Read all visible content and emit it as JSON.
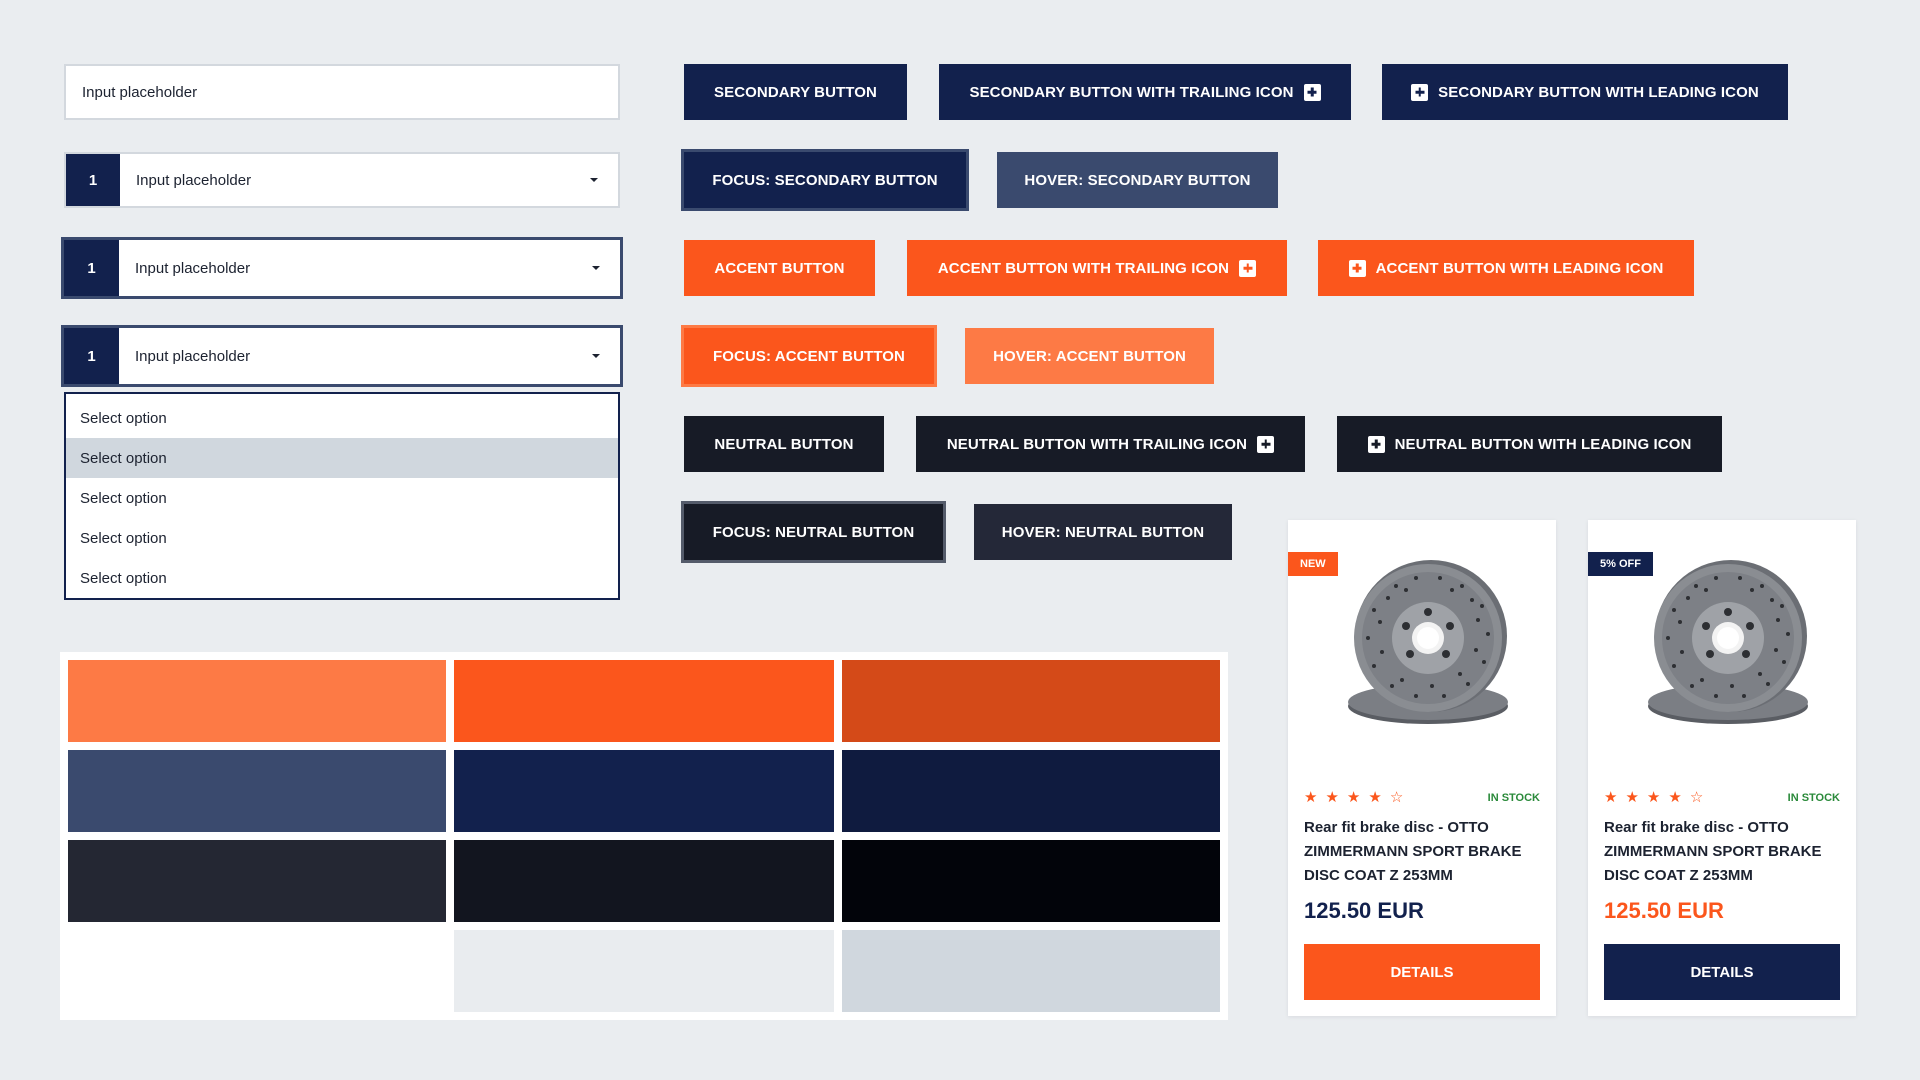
{
  "inputs": {
    "text_placeholder": "Input placeholder",
    "select_number": "1",
    "select_placeholder": "Input placeholder",
    "dropdown_options": [
      "Select option",
      "Select option",
      "Select option",
      "Select option",
      "Select option"
    ]
  },
  "buttons": {
    "secondary": "SECONDARY BUTTON",
    "secondary_trailing": "SECONDARY BUTTON WITH TRAILING ICON",
    "secondary_leading": "SECONDARY BUTTON WITH LEADING ICON",
    "focus_secondary": "FOCUS: SECONDARY BUTTON",
    "hover_secondary": "HOVER: SECONDARY BUTTON",
    "accent": "ACCENT BUTTON",
    "accent_trailing": "ACCENT BUTTON WITH TRAILING ICON",
    "accent_leading": "ACCENT BUTTON WITH LEADING ICON",
    "focus_accent": "FOCUS: ACCENT BUTTON",
    "hover_accent": "HOVER: ACCENT BUTTON",
    "neutral": "NEUTRAL BUTTON",
    "neutral_trailing": "NEUTRAL BUTTON WITH TRAILING ICON",
    "neutral_leading": "NEUTRAL BUTTON WITH LEADING ICON",
    "focus_neutral": "FOCUS: NEUTRAL BUTTON",
    "hover_neutral": "HOVER: NEUTRAL BUTTON",
    "icon": "plus-square-icon"
  },
  "colors": {
    "accent_light": "#fd7a45",
    "accent": "#fb561c",
    "accent_dark": "#d44a18",
    "secondary_light": "#3a4a6e",
    "secondary": "#12214d",
    "secondary_dark": "#0f1b3f",
    "neutral_light": "#242733",
    "neutral": "#12151f",
    "neutral_dark": "#02040a",
    "white": "#ffffff",
    "gray_light": "#e9ecef",
    "gray": "#d0d7de",
    "in_stock": "#2a8a3a"
  },
  "palette": [
    [
      "#fd7a45",
      "#fb561c",
      "#d44a18"
    ],
    [
      "#3a4a6e",
      "#12214d",
      "#0f1b3f"
    ],
    [
      "#242733",
      "#12151f",
      "#02040a"
    ],
    [
      "#ffffff",
      "#e9ecef",
      "#d0d7de"
    ]
  ],
  "products": [
    {
      "badge": "NEW",
      "rating": 4,
      "rating_max": 5,
      "stock": "IN STOCK",
      "title": "Rear fit brake disc - OTTO ZIMMERMANN SPORT BRAKE DISC COAT Z 253MM",
      "price": "125.50 EUR",
      "button": "DETAILS",
      "image": "brake-disc"
    },
    {
      "badge": "5% OFF",
      "rating": 4,
      "rating_max": 5,
      "stock": "IN STOCK",
      "title": "Rear fit brake disc - OTTO ZIMMERMANN SPORT BRAKE DISC COAT Z 253MM",
      "price": "125.50 EUR",
      "button": "DETAILS",
      "image": "brake-disc"
    }
  ]
}
